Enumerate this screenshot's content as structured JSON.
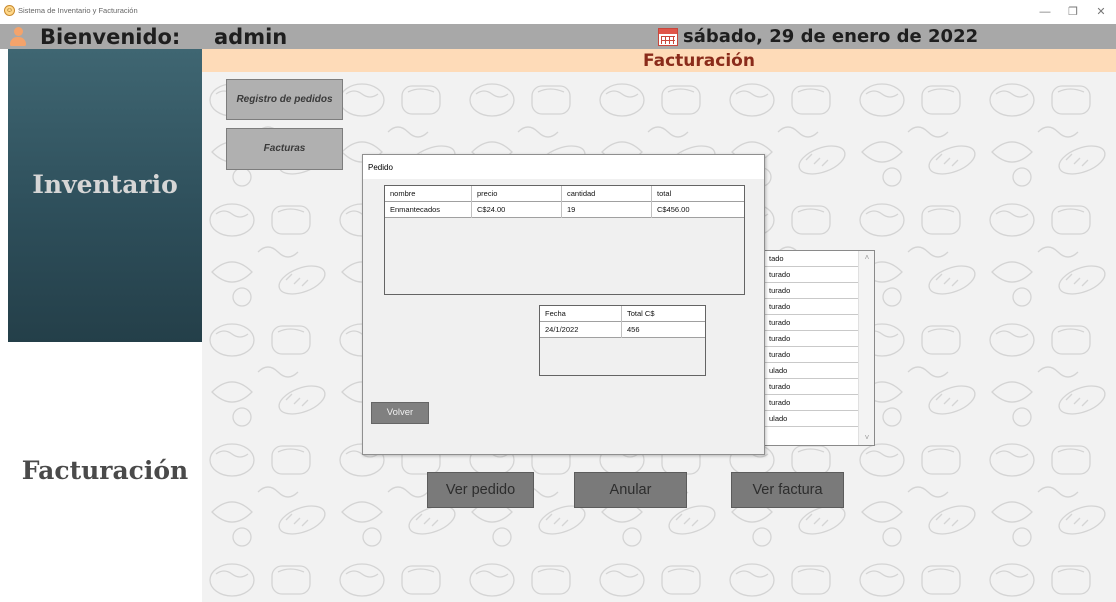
{
  "window": {
    "title": "Sistema de Inventario y Facturación",
    "minimize_glyph": "—",
    "maximize_glyph": "❐",
    "close_glyph": "✕"
  },
  "header": {
    "welcome_label": "Bienvenido:",
    "username": "admin",
    "date": "sábado, 29 de enero de 2022",
    "user_icon": "user-icon",
    "calendar_icon": "calendar-icon"
  },
  "sidebar": {
    "items": [
      {
        "label": "Inventario",
        "active": false
      },
      {
        "label": "Facturación",
        "active": true
      }
    ]
  },
  "section": {
    "title": "Facturación"
  },
  "side_buttons": {
    "registro": "Registro de pedidos",
    "facturas": "Facturas"
  },
  "status_list": {
    "rows": [
      "tado",
      "turado",
      "turado",
      "turado",
      "turado",
      "turado",
      "turado",
      "ulado",
      "turado",
      "turado",
      "ulado"
    ],
    "scroll_up": "˄",
    "scroll_down": "˅"
  },
  "actions": {
    "ver_pedido": "Ver pedido",
    "anular": "Anular",
    "ver_factura": "Ver factura"
  },
  "dialog": {
    "title": "Pedido",
    "order_table": {
      "columns": [
        "nombre",
        "precio",
        "cantidad",
        "total"
      ],
      "rows": [
        [
          "Enmantecados",
          "C$24.00",
          "19",
          "C$456.00"
        ]
      ]
    },
    "invoice_table": {
      "columns": [
        "Fecha",
        "Total C$"
      ],
      "rows": [
        [
          "24/1/2022",
          "456"
        ]
      ]
    },
    "back_button": "Volver"
  },
  "colors": {
    "header_bg": "#a8a8a8",
    "sidebar_bg": "#2e4f5b",
    "banner_bg": "#fedbb8",
    "banner_text": "#8a2b1a",
    "action_button": "#7a7a7a"
  }
}
